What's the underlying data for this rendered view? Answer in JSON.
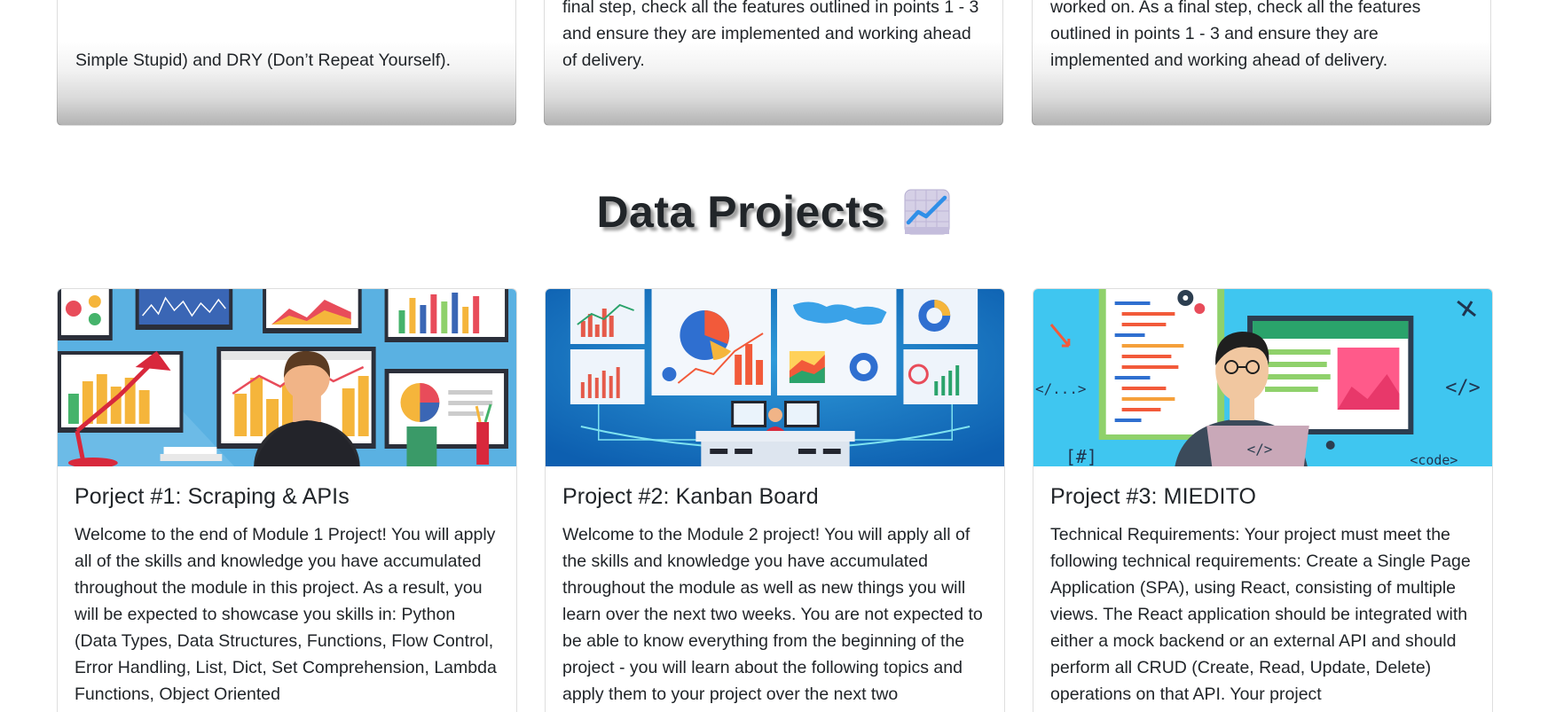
{
  "top_cards": [
    {
      "text": "Simple Stupid) and DRY (Don’t Repeat Yourself)."
    },
    {
      "text": "final step, check all the features outlined in points 1 - 3 and ensure they are implemented and working ahead of delivery."
    },
    {
      "text": "commits per day on your project repository that you worked on. As a final step, check all the features outlined in points 1 - 3 and ensure they are implemented and working ahead of delivery."
    }
  ],
  "section": {
    "title": "Data Projects",
    "emoji_icon": "chart-increasing-icon"
  },
  "projects": [
    {
      "title": "Porject #1: Scraping & APIs",
      "image_icon": "data-analyst-illustration",
      "description": "Welcome to the end of Module 1 Project! You will apply all of the skills and knowledge you have accumulated throughout the module in this project. As a result, you will be expected to showcase you skills in: Python (Data Types, Data Structures, Functions, Flow Control, Error Handling, List, Dict, Set Comprehension, Lambda Functions, Object Oriented"
    },
    {
      "title": "Project #2: Kanban Board",
      "image_icon": "dashboard-control-room-illustration",
      "description": "Welcome to the Module 2 project! You will apply all of the skills and knowledge you have accumulated throughout the module as well as new things you will learn over the next two weeks. You are not expected to be able to know everything from the beginning of the project - you will learn about the following topics and apply them to your project over the next two"
    },
    {
      "title": "Project #3: MIEDITO",
      "image_icon": "developer-coding-illustration",
      "description": "Technical Requirements: Your project must meet the following technical requirements: Create a Single Page Application (SPA), using React, consisting of multiple views. The React application should be integrated with either a mock backend or an external API and should perform all CRUD (Create, Read, Update, Delete) operations on that API. Your project"
    }
  ],
  "illustration_labels": {
    "code_left": "</...>",
    "code_right": "</>",
    "hash": "[#]",
    "code_tag": "<code>",
    "laptop_tag": "</>"
  },
  "colors": {
    "accent_blue": "#5ab1e2",
    "deep_blue": "#0d6fc0",
    "cyan": "#3fc6f0"
  }
}
